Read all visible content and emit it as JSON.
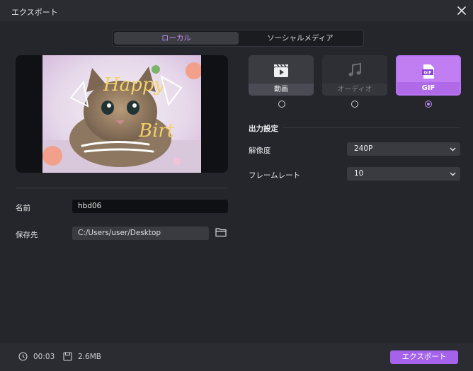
{
  "window": {
    "title": "エクスポート"
  },
  "tabs": {
    "local": "ローカル",
    "social": "ソーシャルメディア"
  },
  "preview": {
    "overlay_text": "Happy Birthday"
  },
  "form": {
    "name_label": "名前",
    "name_value": "hbd06",
    "path_label": "保存先",
    "path_value": "C:/Users/user/Desktop"
  },
  "formats": [
    {
      "label": "動画",
      "icon": "video-icon",
      "selected": false
    },
    {
      "label": "オーディオ",
      "icon": "music-note-icon",
      "selected": false
    },
    {
      "label": "GIF",
      "icon": "gif-file-icon",
      "selected": true
    }
  ],
  "output": {
    "section_title": "出力設定",
    "resolution_label": "解像度",
    "resolution_value": "240P",
    "framerate_label": "フレームレート",
    "framerate_value": "10"
  },
  "footer": {
    "duration": "00:03",
    "size": "2.6MB",
    "export_label": "エクスポート"
  },
  "colors": {
    "accent": "#a463ea",
    "accent_light": "#c58bf5",
    "background": "#25262b"
  }
}
